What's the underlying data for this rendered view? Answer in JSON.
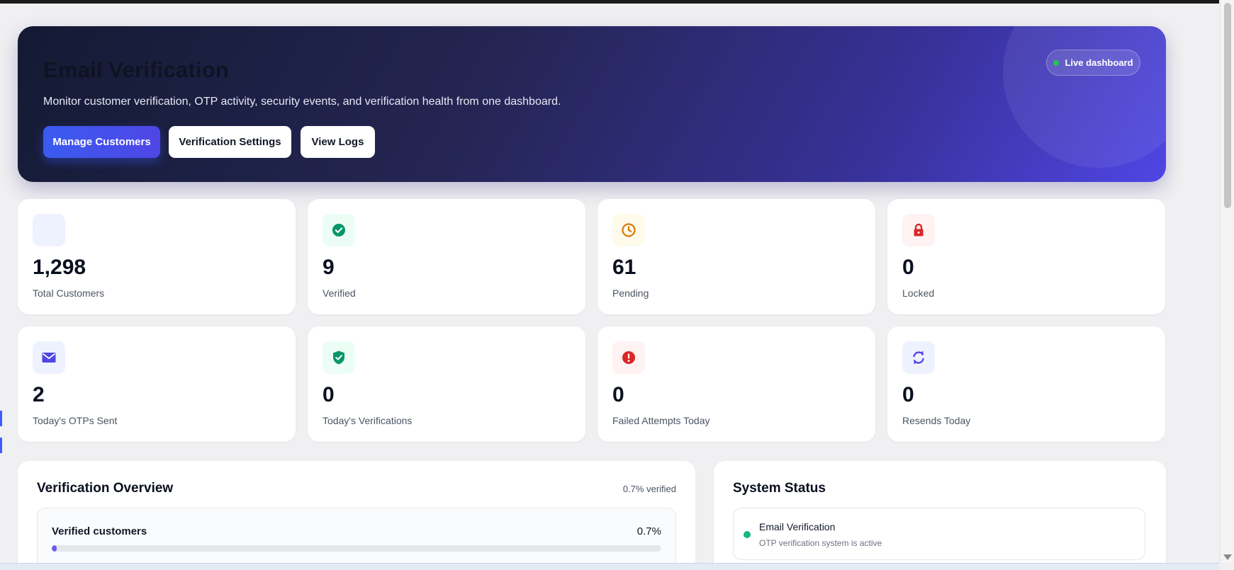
{
  "hero": {
    "title": "Email Verification",
    "subtitle": "Monitor customer verification, OTP activity, security events, and verification health from one dashboard.",
    "buttons": {
      "manage_customers": "Manage Customers",
      "verification_settings": "Verification Settings",
      "view_logs": "View Logs"
    },
    "live_badge": "Live dashboard"
  },
  "stats": [
    {
      "value": "1,298",
      "label": "Total Customers",
      "icon": "users-icon",
      "icon_bg": "#eef2ff",
      "icon_color": "#4f46e5"
    },
    {
      "value": "9",
      "label": "Verified",
      "icon": "check-circle-icon",
      "icon_bg": "#ecfdf5",
      "icon_color": "#059669"
    },
    {
      "value": "61",
      "label": "Pending",
      "icon": "clock-icon",
      "icon_bg": "#fffbeb",
      "icon_color": "#d97706"
    },
    {
      "value": "0",
      "label": "Locked",
      "icon": "lock-icon",
      "icon_bg": "#fef2f2",
      "icon_color": "#dc2626"
    },
    {
      "value": "2",
      "label": "Today's OTPs Sent",
      "icon": "envelope-icon",
      "icon_bg": "#eef2ff",
      "icon_color": "#4f46e5"
    },
    {
      "value": "0",
      "label": "Today's Verifications",
      "icon": "shield-check-icon",
      "icon_bg": "#ecfdf5",
      "icon_color": "#059669"
    },
    {
      "value": "0",
      "label": "Failed Attempts Today",
      "icon": "alert-circle-icon",
      "icon_bg": "#fef2f2",
      "icon_color": "#dc2626"
    },
    {
      "value": "0",
      "label": "Resends Today",
      "icon": "refresh-icon",
      "icon_bg": "#eef2ff",
      "icon_color": "#4f46e5"
    }
  ],
  "overview": {
    "title": "Verification Overview",
    "meta": "0.7% verified",
    "progress_label": "Verified customers",
    "progress_text": "0.7%",
    "progress_value": 0.7
  },
  "system_status": {
    "title": "System Status",
    "items": [
      {
        "name": "Email Verification",
        "description": "OTP verification system is active",
        "color": "#10b981"
      }
    ]
  },
  "colors": {
    "accent": "#4f46e5",
    "primary_button": "#3b5bfd",
    "success": "#10b981"
  }
}
